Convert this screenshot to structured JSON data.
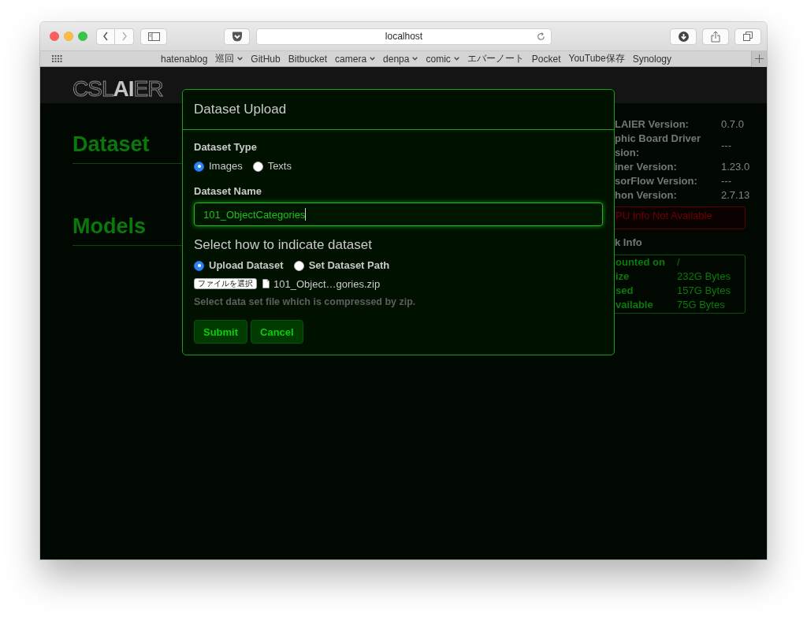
{
  "browser": {
    "address": "localhost",
    "back_disabled": false,
    "forward_disabled": true,
    "bookmarks": [
      {
        "label": "hatenablog",
        "kind": "link"
      },
      {
        "label": "巡回",
        "kind": "folder"
      },
      {
        "label": "GitHub",
        "kind": "link"
      },
      {
        "label": "Bitbucket",
        "kind": "link"
      },
      {
        "label": "camera",
        "kind": "folder"
      },
      {
        "label": "denpa",
        "kind": "folder"
      },
      {
        "label": "comic",
        "kind": "folder"
      },
      {
        "label": "エバーノート",
        "kind": "link"
      },
      {
        "label": "Pocket",
        "kind": "link"
      },
      {
        "label": "YouTube保存",
        "kind": "link"
      },
      {
        "label": "Synology",
        "kind": "link"
      }
    ]
  },
  "header": {
    "logo": [
      {
        "text": "CSL",
        "emphasis": false
      },
      {
        "text": "AI",
        "emphasis": true
      },
      {
        "text": "ER",
        "emphasis": false
      }
    ]
  },
  "sidebar": {
    "sections": [
      "Dataset",
      "Models"
    ]
  },
  "system_info": {
    "rows": [
      {
        "label": "LAIER Version:",
        "value": "0.7.0"
      },
      {
        "label": "phic Board Driver\nsion:",
        "value": "---"
      },
      {
        "label": "iner Version:",
        "value": "1.23.0"
      },
      {
        "label": "sorFlow Version:",
        "value": "---"
      },
      {
        "label": "hon Version:",
        "value": "2.7.13"
      }
    ],
    "alert": "PU Info Not Available"
  },
  "disk_info": {
    "title": "k Info",
    "rows": [
      {
        "label": "ounted on",
        "value": "/"
      },
      {
        "label": "ize",
        "value": "232G Bytes"
      },
      {
        "label": "sed",
        "value": "157G Bytes"
      },
      {
        "label": "vailable",
        "value": "75G Bytes"
      }
    ]
  },
  "modal": {
    "title": "Dataset Upload",
    "dataset_type": {
      "label": "Dataset Type",
      "options": [
        {
          "label": "Images",
          "selected": true
        },
        {
          "label": "Texts",
          "selected": false
        }
      ]
    },
    "dataset_name": {
      "label": "Dataset Name",
      "value": "101_ObjectCategories",
      "focused": true
    },
    "source": {
      "heading": "Select how to indicate dataset",
      "options": [
        {
          "label": "Upload Dataset",
          "selected": true
        },
        {
          "label": "Set Dataset Path",
          "selected": false
        }
      ]
    },
    "file": {
      "button": "ファイルを選択",
      "filename": "101_Object…gories.zip"
    },
    "help": "Select data set file which is compressed by zip.",
    "buttons": [
      "Submit",
      "Cancel"
    ]
  }
}
